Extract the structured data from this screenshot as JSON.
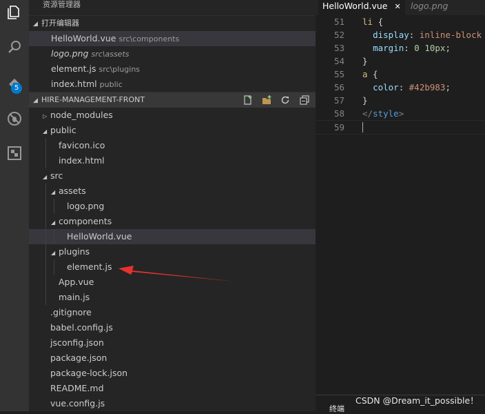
{
  "activity_bar": {
    "items": [
      {
        "name": "explorer",
        "icon": "files-icon"
      },
      {
        "name": "search",
        "icon": "search-icon"
      },
      {
        "name": "scm",
        "icon": "source-control-icon",
        "badge": "5"
      },
      {
        "name": "debug",
        "icon": "debug-icon"
      },
      {
        "name": "extensions",
        "icon": "extensions-icon"
      }
    ]
  },
  "sidebar": {
    "title": "资源管理器",
    "open_editors": {
      "header": "打开编辑器",
      "items": [
        {
          "name": "HelloWorld.vue",
          "desc": "src\\components"
        },
        {
          "name": "logo.png",
          "desc": "src\\assets"
        },
        {
          "name": "element.js",
          "desc": "src\\plugins"
        },
        {
          "name": "index.html",
          "desc": "public"
        }
      ]
    },
    "project": {
      "header": "HIRE-MANAGEMENT-FRONT",
      "toolbar": [
        "new-file-icon",
        "new-folder-icon",
        "refresh-icon",
        "collapse-all-icon"
      ],
      "tree": [
        {
          "label": "node_modules",
          "depth": 0,
          "folder": true,
          "expanded": false
        },
        {
          "label": "public",
          "depth": 0,
          "folder": true,
          "expanded": true
        },
        {
          "label": "favicon.ico",
          "depth": 1
        },
        {
          "label": "index.html",
          "depth": 1
        },
        {
          "label": "src",
          "depth": 0,
          "folder": true,
          "expanded": true
        },
        {
          "label": "assets",
          "depth": 1,
          "folder": true,
          "expanded": true
        },
        {
          "label": "logo.png",
          "depth": 2
        },
        {
          "label": "components",
          "depth": 1,
          "folder": true,
          "expanded": true
        },
        {
          "label": "HelloWorld.vue",
          "depth": 2,
          "selected": true
        },
        {
          "label": "plugins",
          "depth": 1,
          "folder": true,
          "expanded": true
        },
        {
          "label": "element.js",
          "depth": 2
        },
        {
          "label": "App.vue",
          "depth": 1
        },
        {
          "label": "main.js",
          "depth": 1
        },
        {
          "label": ".gitignore",
          "depth": 0
        },
        {
          "label": "babel.config.js",
          "depth": 0
        },
        {
          "label": "jsconfig.json",
          "depth": 0
        },
        {
          "label": "package.json",
          "depth": 0
        },
        {
          "label": "package-lock.json",
          "depth": 0
        },
        {
          "label": "README.md",
          "depth": 0
        },
        {
          "label": "vue.config.js",
          "depth": 0
        }
      ]
    }
  },
  "editor": {
    "tabs": [
      {
        "label": "HelloWorld.vue",
        "close": "✕",
        "active": true
      },
      {
        "label": "logo.png",
        "active": false
      }
    ],
    "lines": [
      {
        "n": "51",
        "tokens": [
          [
            "sel",
            "li"
          ],
          [
            "punct",
            " {"
          ]
        ]
      },
      {
        "n": "52",
        "tokens": [
          [
            "punct",
            "  "
          ],
          [
            "prop",
            "display"
          ],
          [
            "punct",
            ": "
          ],
          [
            "val",
            "inline-block"
          ]
        ]
      },
      {
        "n": "53",
        "tokens": [
          [
            "punct",
            "  "
          ],
          [
            "prop",
            "margin"
          ],
          [
            "punct",
            ": "
          ],
          [
            "num",
            "0 10px"
          ],
          [
            "punct",
            ";"
          ]
        ]
      },
      {
        "n": "54",
        "tokens": [
          [
            "punct",
            "}"
          ]
        ]
      },
      {
        "n": "55",
        "tokens": [
          [
            "sel",
            "a"
          ],
          [
            "punct",
            " {"
          ]
        ]
      },
      {
        "n": "56",
        "tokens": [
          [
            "punct",
            "  "
          ],
          [
            "prop",
            "color"
          ],
          [
            "punct",
            ": "
          ],
          [
            "val",
            "#42b983"
          ],
          [
            "punct",
            ";"
          ]
        ]
      },
      {
        "n": "57",
        "tokens": [
          [
            "punct",
            "}"
          ]
        ]
      },
      {
        "n": "58",
        "tokens": [
          [
            "tag",
            "</"
          ],
          [
            "tagname",
            "style"
          ],
          [
            "tag",
            ">"
          ]
        ]
      },
      {
        "n": "59",
        "tokens": [],
        "current": true
      }
    ]
  },
  "panel": {
    "label": "终端"
  },
  "watermark": "CSDN @Dream_it_possible！",
  "annotation": {
    "color": "#e8322d",
    "target": "element.js"
  }
}
